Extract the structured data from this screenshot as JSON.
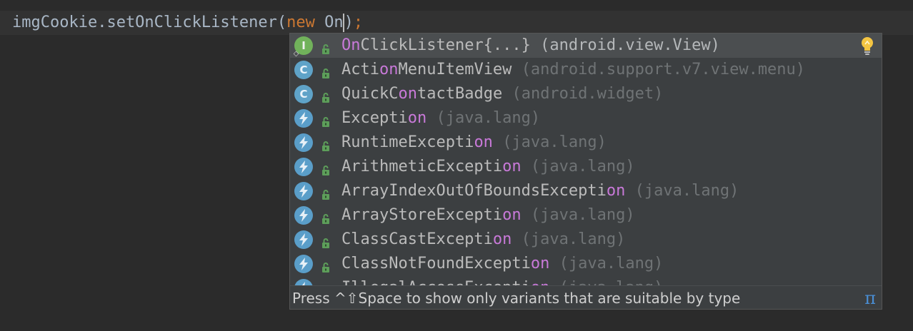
{
  "editor": {
    "code_before": "imgCookie.setOnClickListener(",
    "keyword": "new",
    "typed": " On",
    "code_after": ")",
    "semicolon": ";"
  },
  "completion": {
    "items": [
      {
        "kind": "interface",
        "kind_letter": "I",
        "prefix": "",
        "match": "On",
        "rest": "ClickListener{...}",
        "package": "(android.view.View)",
        "selected": true
      },
      {
        "kind": "class",
        "kind_letter": "C",
        "prefix": "Acti",
        "match": "on",
        "rest": "MenuItemView",
        "package": "(android.support.v7.view.menu)"
      },
      {
        "kind": "class",
        "kind_letter": "C",
        "prefix": "QuickC",
        "match": "on",
        "rest": "tactBadge",
        "package": "(android.widget)"
      },
      {
        "kind": "exception",
        "kind_letter": "",
        "prefix": "Excepti",
        "match": "on",
        "rest": "",
        "package": "(java.lang)"
      },
      {
        "kind": "exception",
        "kind_letter": "",
        "prefix": "RuntimeExcepti",
        "match": "on",
        "rest": "",
        "package": "(java.lang)"
      },
      {
        "kind": "exception",
        "kind_letter": "",
        "prefix": "ArithmeticExcepti",
        "match": "on",
        "rest": "",
        "package": "(java.lang)"
      },
      {
        "kind": "exception",
        "kind_letter": "",
        "prefix": "ArrayIndexOutOfBoundsExcepti",
        "match": "on",
        "rest": "",
        "package": "(java.lang)"
      },
      {
        "kind": "exception",
        "kind_letter": "",
        "prefix": "ArrayStoreExcepti",
        "match": "on",
        "rest": "",
        "package": "(java.lang)"
      },
      {
        "kind": "exception",
        "kind_letter": "",
        "prefix": "ClassCastExcepti",
        "match": "on",
        "rest": "",
        "package": "(java.lang)"
      },
      {
        "kind": "exception",
        "kind_letter": "",
        "prefix": "ClassNotFoundExcepti",
        "match": "on",
        "rest": "",
        "package": "(java.lang)"
      },
      {
        "kind": "exception",
        "kind_letter": "",
        "prefix": "IllegalAccessExcepti",
        "match": "on",
        "rest": "",
        "package": "(java.lang)"
      }
    ],
    "hint": "Press ^⇧Space to show only variants that are suitable by type",
    "pi_symbol": "π",
    "icons": {
      "class": "class-icon",
      "interface": "interface-icon",
      "exception": "exception-icon",
      "visibility": "public-lock-icon",
      "intention": "lightbulb-icon"
    }
  },
  "colors": {
    "background": "#2b2b2b",
    "current_line": "#323232",
    "keyword": "#cc7832",
    "text": "#a9b7c6",
    "match": "#c879d8",
    "package": "#6f7375",
    "popup": "#3c3f41",
    "selection": "#4b4e50",
    "hint_link": "#4a8fd6"
  }
}
